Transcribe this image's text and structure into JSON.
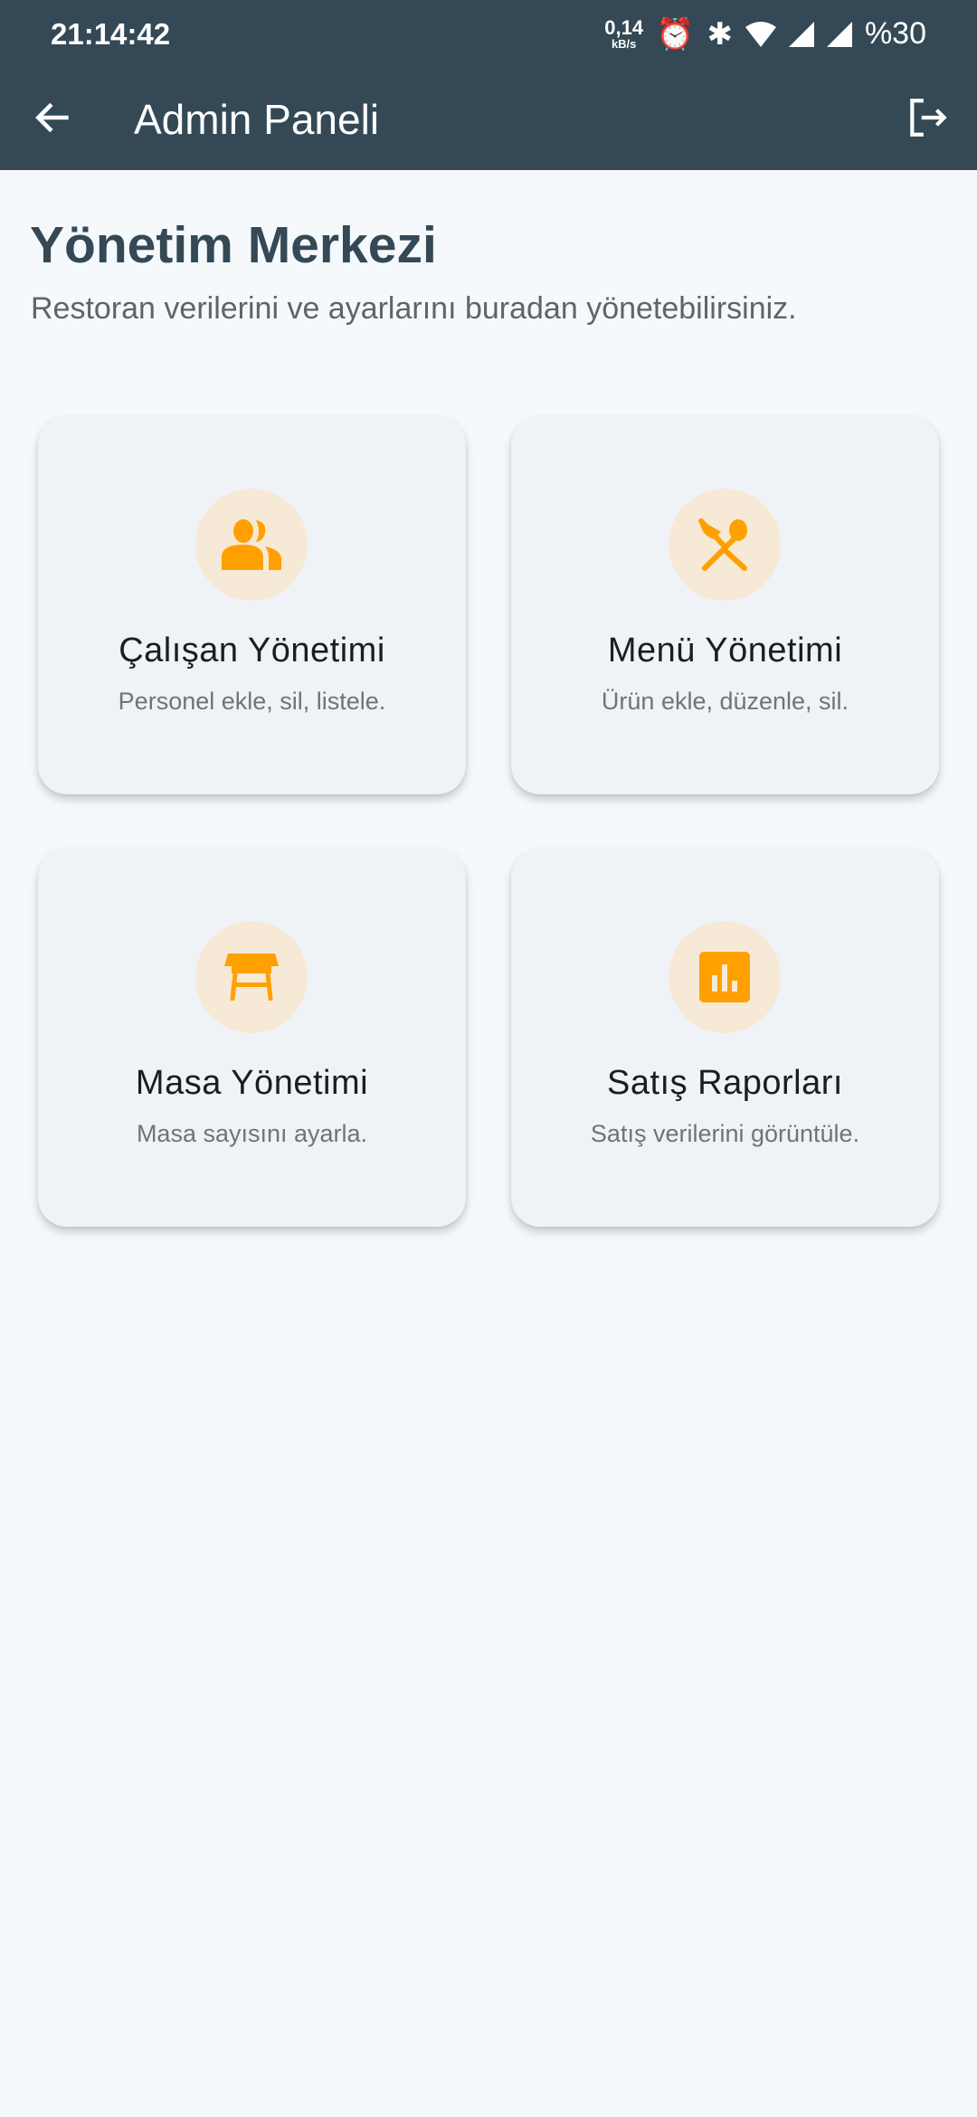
{
  "status_bar": {
    "time": "21:14:42",
    "net_speed": "0,14",
    "net_unit": "kB/s",
    "battery": "%30"
  },
  "app_bar": {
    "title": "Admin Paneli",
    "back_icon": "arrow-left-icon",
    "logout_icon": "logout-icon"
  },
  "header": {
    "title": "Yönetim Merkezi",
    "subtitle": "Restoran verilerini ve ayarlarını buradan yönetebilirsiniz."
  },
  "cards": [
    {
      "title": "Çalışan Yönetimi",
      "subtitle": "Personel ekle, sil, listele.",
      "icon": "people-icon"
    },
    {
      "title": "Menü Yönetimi",
      "subtitle": "Ürün ekle, düzenle, sil.",
      "icon": "restaurant-icon"
    },
    {
      "title": "Masa Yönetimi",
      "subtitle": "Masa sayısını ayarla.",
      "icon": "table-icon"
    },
    {
      "title": "Satış Raporları",
      "subtitle": "Satış verilerini görüntüle.",
      "icon": "bar-chart-icon"
    }
  ],
  "colors": {
    "primary": "#344955",
    "accent": "#FFA000",
    "background": "#F5F9FC"
  }
}
